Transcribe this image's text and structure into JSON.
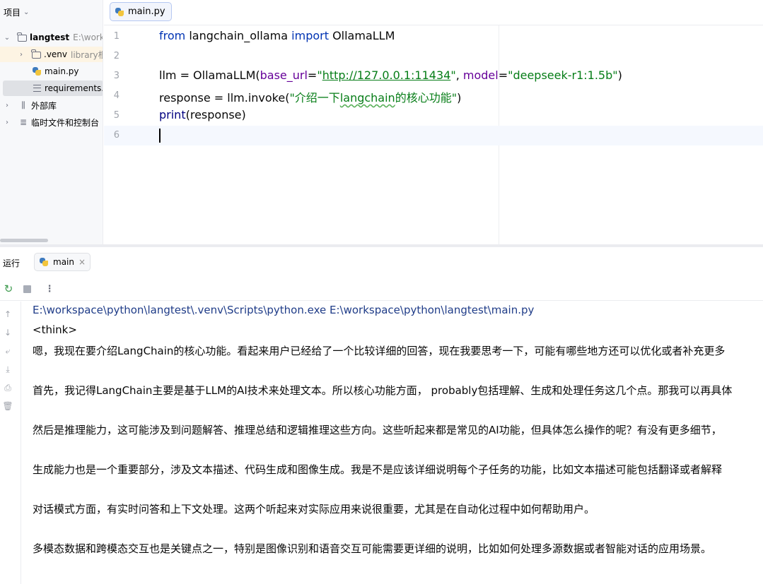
{
  "project": {
    "title": "项目",
    "tree": [
      {
        "label": "langtest",
        "hint": "E:\\work"
      },
      {
        "label": ".venv",
        "hint": "library根"
      },
      {
        "label": "main.py"
      },
      {
        "label": "requirements.t"
      },
      {
        "label": "外部库"
      },
      {
        "label": "临时文件和控制台"
      }
    ]
  },
  "editor": {
    "tab_label": "main.py",
    "line_numbers": [
      "1",
      "2",
      "3",
      "4",
      "5",
      "6"
    ],
    "code": {
      "l1": {
        "kw1": "from",
        "mod": " langchain_ollama ",
        "kw2": "import",
        "cls": " OllamaLLM"
      },
      "l3": {
        "a": "llm = OllamaLLM(",
        "p1": "base_url",
        "eq1": "=",
        "q1": "\"",
        "url": "http://127.0.0.1:11434",
        "q2": "\"",
        "comma": ", ",
        "p2": "model",
        "eq2": "=",
        "s2": "\"deepseek-r1:1.5b\"",
        "close": ")"
      },
      "l4": {
        "a": "response = llm.invoke(",
        "s1": "\"介绍一下",
        "typo": "langchain",
        "s2": "的核心功能\"",
        "close": ")"
      },
      "l5": {
        "fn": "print",
        "rest": "(response)"
      }
    }
  },
  "run": {
    "panel_label": "运行",
    "tab_label": "main",
    "close_glyph": "×",
    "more_glyph": "⋮",
    "console": {
      "command": "E:\\workspace\\python\\langtest\\.venv\\Scripts\\python.exe E:\\workspace\\python\\langtest\\main.py",
      "lines": [
        "<think>",
        "嗯，我现在要介绍LangChain的核心功能。看起来用户已经给了一个比较详细的回答，现在我要思考一下，可能有哪些地方还可以优化或者补充更多",
        "",
        "首先，我记得LangChain主要是基于LLM的AI技术来处理文本。所以核心功能方面， probably包括理解、生成和处理任务这几个点。那我可以再具体",
        "",
        "然后是推理能力，这可能涉及到问题解答、推理总结和逻辑推理这些方向。这些听起来都是常见的AI功能，但具体怎么操作的呢？有没有更多细节，",
        "",
        "生成能力也是一个重要部分，涉及文本描述、代码生成和图像生成。我是不是应该详细说明每个子任务的功能，比如文本描述可能包括翻译或者解释",
        "",
        "对话模式方面，有实时问答和上下文处理。这两个听起来对实际应用来说很重要，尤其是在自动化过程中如何帮助用户。",
        "",
        "多模态数据和跨模态交互也是关键点之一，特别是图像识别和语音交互可能需要更详细的说明，比如如何处理多源数据或者智能对话的应用场景。"
      ]
    }
  },
  "colors": {
    "keyword": "#0033b3",
    "string": "#067d17",
    "param": "#660099",
    "command": "#1f3c88"
  }
}
